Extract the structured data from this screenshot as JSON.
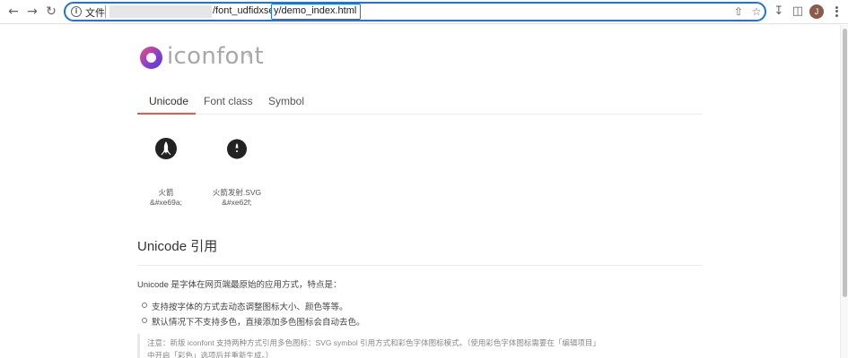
{
  "browser": {
    "file_label": "文件",
    "url_path": "/font_udfidxset",
    "url_edit": "y/demo_index.html",
    "avatar_letter": "J",
    "icons": {
      "back": "back-arrow-icon",
      "forward": "forward-arrow-icon",
      "reload": "reload-icon",
      "info": "info-icon",
      "share": "share-icon",
      "bookmark": "star-icon",
      "download": "download-icon",
      "sidepanel": "side-panel-icon",
      "menu": "kebab-menu-icon"
    },
    "accent": "#1a73e8"
  },
  "page": {
    "logo_text": "iconfont",
    "logo_plus": "+",
    "tabs": [
      {
        "label": "Unicode",
        "active": true
      },
      {
        "label": "Font class",
        "active": false
      },
      {
        "label": "Symbol",
        "active": false
      }
    ],
    "tab_accent": "#e05b4b",
    "icons": [
      {
        "name": "火箭",
        "code": "&#xe69a;",
        "glyph": "rocket-icon"
      },
      {
        "name": "火箭发射.SVG",
        "code": "&#xe62f;",
        "glyph": "rocket-launch-icon"
      }
    ],
    "section_title": "Unicode 引用",
    "intro": "Unicode 是字体在网页端最原始的应用方式，特点是：",
    "bullets": [
      "支持按字体的方式去动态调整图标大小、颜色等等。",
      "默认情况下不支持多色，直接添加多色图标会自动去色。"
    ],
    "note_lines": [
      "注意：新版 iconfont 支持两种方式引用多色图标：SVG symbol 引用方式和彩色字体图标模式。（使用彩色字体图标需要在「编辑项目」",
      "中开启「彩色」选项后并重新生成。）"
    ]
  }
}
